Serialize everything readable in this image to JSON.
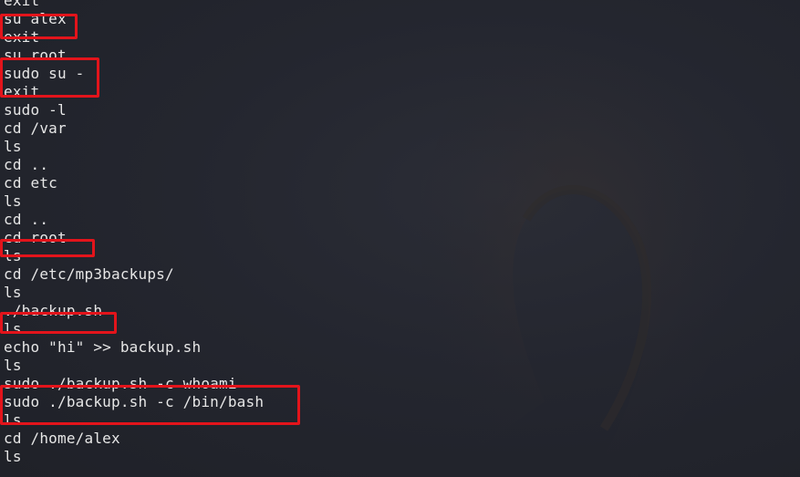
{
  "terminal": {
    "lines": [
      "exit",
      "su alex",
      "exit",
      "su root",
      "sudo su -",
      "exit",
      "sudo -l",
      "cd /var",
      "ls",
      "cd ..",
      "cd etc",
      "ls",
      "cd ..",
      "cd root",
      "ls",
      "cd /etc/mp3backups/",
      "ls",
      "./backup.sh",
      "ls",
      "echo \"hi\" >> backup.sh",
      "ls",
      "sudo ./backup.sh -c whoami",
      "sudo ./backup.sh -c /bin/bash",
      "ls",
      "cd /home/alex",
      "ls"
    ]
  },
  "colors": {
    "background": "#23252e",
    "text": "#e6e6e6",
    "highlight": "#e3141b"
  }
}
